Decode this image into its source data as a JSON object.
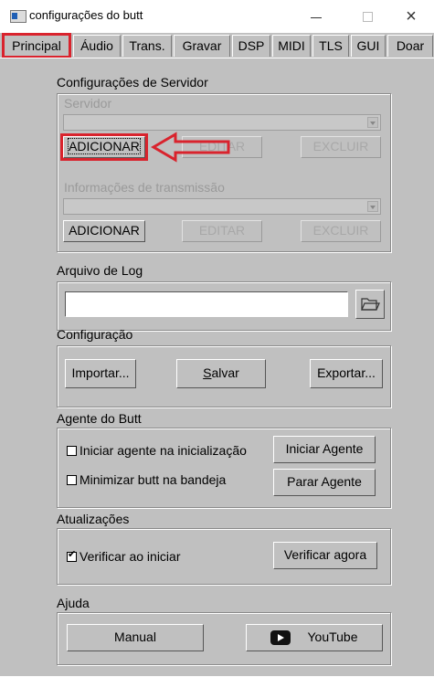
{
  "window": {
    "title": "configurações do butt"
  },
  "tabs": [
    {
      "label": "Principal"
    },
    {
      "label": "Áudio"
    },
    {
      "label": "Trans."
    },
    {
      "label": "Gravar"
    },
    {
      "label": "DSP"
    },
    {
      "label": "MIDI"
    },
    {
      "label": "TLS"
    },
    {
      "label": "GUI"
    },
    {
      "label": "Doar"
    }
  ],
  "server_config": {
    "title": "Configurações de Servidor",
    "server_label": "Servidor",
    "server_selected": "",
    "add": "ADICIONAR",
    "edit": "EDITAR",
    "delete": "EXCLUIR",
    "stream_info_label": "Informações de transmissão",
    "stream_info_selected": "",
    "add2": "ADICIONAR",
    "edit2": "EDITAR",
    "delete2": "EXCLUIR"
  },
  "log": {
    "title": "Arquivo de Log",
    "value": ""
  },
  "config": {
    "title": "Configuração",
    "import": "Importar...",
    "save": "Salvar",
    "export": "Exportar..."
  },
  "agent": {
    "title": "Agente do Butt",
    "start_on_boot": "Iniciar agente na inicialização",
    "start_on_boot_checked": false,
    "start_agent": "Iniciar Agente",
    "minimize_tray": "Minimizar butt na bandeja",
    "minimize_tray_checked": false,
    "stop_agent": "Parar Agente"
  },
  "updates": {
    "title": "Atualizações",
    "check_on_start": "Verificar ao iniciar",
    "check_on_start_checked": true,
    "check_now": "Verificar agora"
  },
  "help": {
    "title": "Ajuda",
    "manual": "Manual",
    "youtube": "YouTube"
  },
  "annotation_color": "#d9232d"
}
